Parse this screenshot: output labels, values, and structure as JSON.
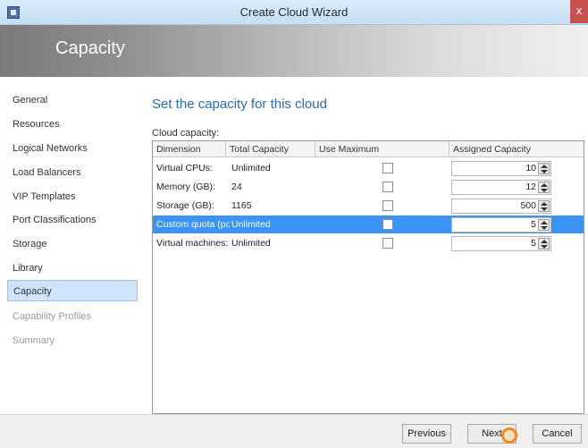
{
  "window": {
    "title": "Create Cloud Wizard",
    "close": "x"
  },
  "header": {
    "title": "Capacity"
  },
  "sidebar": {
    "items": [
      {
        "label": "General",
        "state": "normal"
      },
      {
        "label": "Resources",
        "state": "normal"
      },
      {
        "label": "Logical Networks",
        "state": "normal"
      },
      {
        "label": "Load Balancers",
        "state": "normal"
      },
      {
        "label": "VIP Templates",
        "state": "normal"
      },
      {
        "label": "Port Classifications",
        "state": "normal"
      },
      {
        "label": "Storage",
        "state": "normal"
      },
      {
        "label": "Library",
        "state": "normal"
      },
      {
        "label": "Capacity",
        "state": "active"
      },
      {
        "label": "Capability Profiles",
        "state": "disabled"
      },
      {
        "label": "Summary",
        "state": "disabled"
      }
    ]
  },
  "main": {
    "heading": "Set the capacity for this cloud",
    "capacity_label": "Cloud capacity:",
    "columns": [
      "Dimension",
      "Total Capacity",
      "Use Maximum",
      "Assigned Capacity"
    ],
    "rows": [
      {
        "dimension": "Virtual CPUs:",
        "total": "Unlimited",
        "use_max": false,
        "assigned": "10"
      },
      {
        "dimension": "Memory (GB):",
        "total": "24",
        "use_max": false,
        "assigned": "12"
      },
      {
        "dimension": "Storage (GB):",
        "total": "1165",
        "use_max": false,
        "assigned": "500"
      },
      {
        "dimension": "Custom quota (points):",
        "total": "Unlimited",
        "use_max": false,
        "assigned": "5",
        "selected": true
      },
      {
        "dimension": "Virtual machines:",
        "total": "Unlimited",
        "use_max": false,
        "assigned": "5"
      }
    ]
  },
  "footer": {
    "previous": "Previous",
    "next": "Next",
    "cancel": "Cancel"
  },
  "colors": {
    "accent": "#2a6ab8",
    "selected_row": "#3a93f5",
    "active_nav": "#cfe4fb"
  }
}
